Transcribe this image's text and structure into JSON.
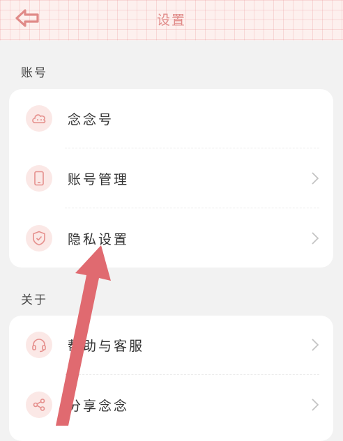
{
  "header": {
    "title": "设置",
    "back_icon": "back-arrow-icon"
  },
  "account_section": {
    "label": "账号",
    "items": [
      {
        "label": "念念号",
        "icon": "cloud-face-icon",
        "has_chevron": false
      },
      {
        "label": "账号管理",
        "icon": "phone-icon",
        "has_chevron": true
      },
      {
        "label": "隐私设置",
        "icon": "shield-icon",
        "has_chevron": true
      }
    ]
  },
  "about_section": {
    "label": "关于",
    "items": [
      {
        "label": "帮助与客服",
        "icon": "headset-icon",
        "has_chevron": true
      },
      {
        "label": "分享念念",
        "icon": "share-icon",
        "has_chevron": true
      }
    ]
  },
  "colors": {
    "accent": "#e08a88",
    "background": "#f2f2f2",
    "card": "#ffffff",
    "arrow": "#e06a70"
  }
}
